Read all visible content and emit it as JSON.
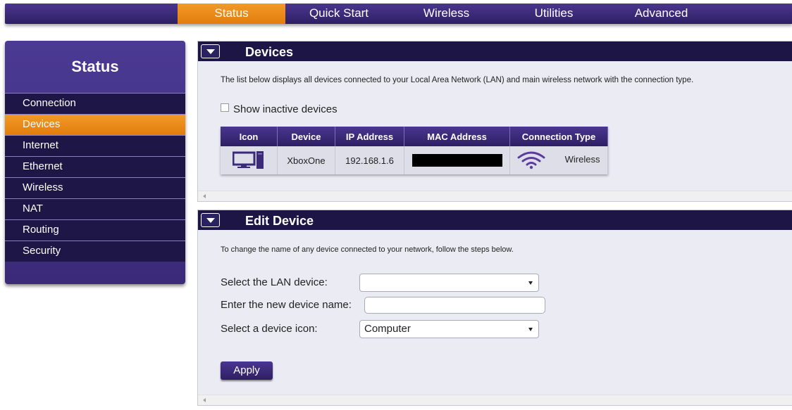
{
  "topnav": {
    "tabs": [
      {
        "label": "Status",
        "active": true
      },
      {
        "label": "Quick Start",
        "active": false
      },
      {
        "label": "Wireless",
        "active": false
      },
      {
        "label": "Utilities",
        "active": false
      },
      {
        "label": "Advanced",
        "active": false
      }
    ]
  },
  "sidebar": {
    "title": "Status",
    "items": [
      {
        "label": "Connection",
        "active": false
      },
      {
        "label": "Devices",
        "active": true
      },
      {
        "label": "Internet",
        "active": false
      },
      {
        "label": "Ethernet",
        "active": false
      },
      {
        "label": "Wireless",
        "active": false
      },
      {
        "label": "NAT",
        "active": false
      },
      {
        "label": "Routing",
        "active": false
      },
      {
        "label": "Security",
        "active": false
      }
    ]
  },
  "devices_panel": {
    "title": "Devices",
    "description": "The list below displays all devices connected to your Local Area Network (LAN) and main wireless network with the connection type.",
    "show_inactive_label": "Show inactive devices",
    "show_inactive_checked": false,
    "table": {
      "headers": [
        "Icon",
        "Device",
        "IP Address",
        "MAC Address",
        "Connection Type"
      ],
      "rows": [
        {
          "icon": "computer-icon",
          "device": "XboxOne",
          "ip": "192.168.1.6",
          "mac": "",
          "connection_icon": "wifi-icon",
          "connection": "Wireless"
        }
      ]
    }
  },
  "edit_panel": {
    "title": "Edit Device",
    "description": "To change the name of any device connected to your network, follow the steps below.",
    "select_device_label": "Select the LAN device:",
    "select_device_value": "",
    "new_name_label": "Enter the new device name:",
    "new_name_value": "",
    "select_icon_label": "Select a device icon:",
    "select_icon_value": "Computer",
    "apply_label": "Apply"
  },
  "colors": {
    "accent_orange": "#e8870f",
    "nav_purple": "#3a2a78",
    "header_dark": "#1c1545",
    "wifi_purple": "#5b3c9c"
  }
}
